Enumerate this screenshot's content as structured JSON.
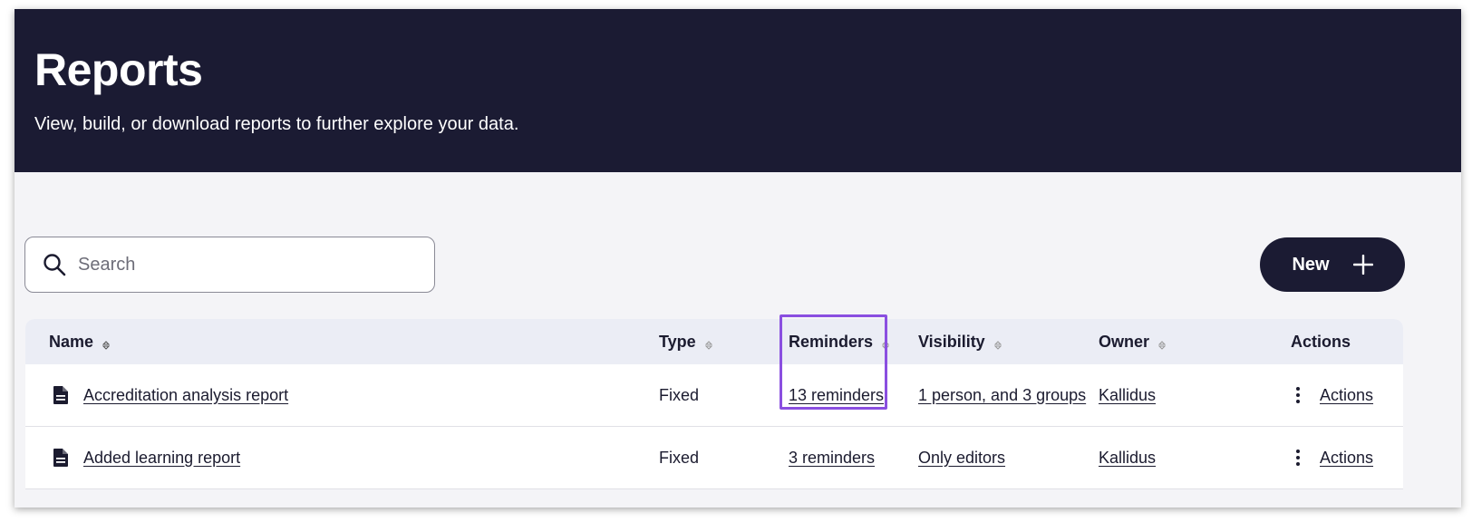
{
  "header": {
    "title": "Reports",
    "subtitle": "View, build, or download reports to further explore your data."
  },
  "search": {
    "placeholder": "Search",
    "value": ""
  },
  "new_button": {
    "label": "New"
  },
  "table": {
    "columns": [
      "Name",
      "Type",
      "Reminders",
      "Visibility",
      "Owner",
      "Actions"
    ],
    "rows": [
      {
        "name": "Accreditation analysis report",
        "type": "Fixed",
        "reminders": "13 reminders",
        "visibility": "1 person, and 3 groups",
        "owner": "Kallidus",
        "actions": "Actions"
      },
      {
        "name": "Added learning report",
        "type": "Fixed",
        "reminders": "3 reminders",
        "visibility": "Only editors",
        "owner": "Kallidus",
        "actions": "Actions"
      }
    ]
  },
  "colors": {
    "header_bg": "#1b1b33",
    "highlight": "#8a4fe0",
    "page_bg": "#f4f4f7",
    "table_header_bg": "#ebedf5"
  },
  "icons": {
    "search": "search-icon",
    "plus": "plus-icon",
    "document": "document-icon",
    "sort": "sort-icon",
    "kebab": "kebab-menu-icon"
  }
}
